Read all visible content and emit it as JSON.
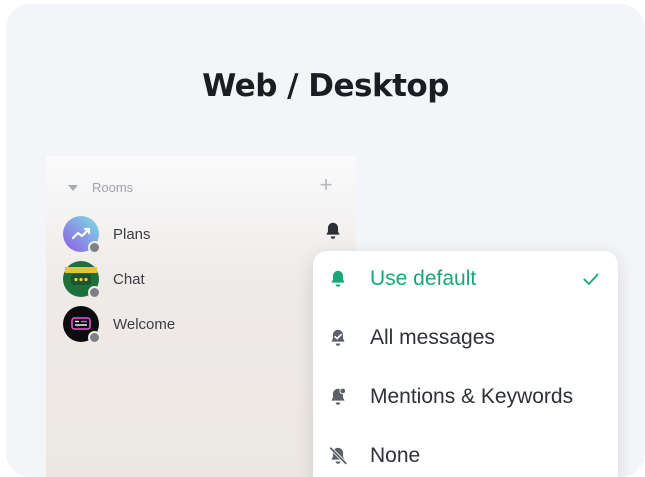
{
  "title": "Web / Desktop",
  "sidebar": {
    "section_label": "Rooms",
    "rooms": [
      {
        "name": "Plans",
        "avatar_icon": "chart-trend-icon"
      },
      {
        "name": "Chat",
        "avatar_icon": "chat-bubble-icon"
      },
      {
        "name": "Welcome",
        "avatar_icon": "welcome-sign-icon"
      }
    ]
  },
  "notification_menu": {
    "options": [
      {
        "label": "Use default",
        "icon": "bell-filled-icon",
        "selected": true
      },
      {
        "label": "All messages",
        "icon": "bell-check-icon",
        "selected": false
      },
      {
        "label": "Mentions & Keywords",
        "icon": "bell-mention-icon",
        "selected": false
      },
      {
        "label": "None",
        "icon": "bell-off-icon",
        "selected": false
      }
    ]
  },
  "colors": {
    "accent": "#18a877",
    "text": "#2e3138",
    "muted": "#9fa3ab"
  }
}
